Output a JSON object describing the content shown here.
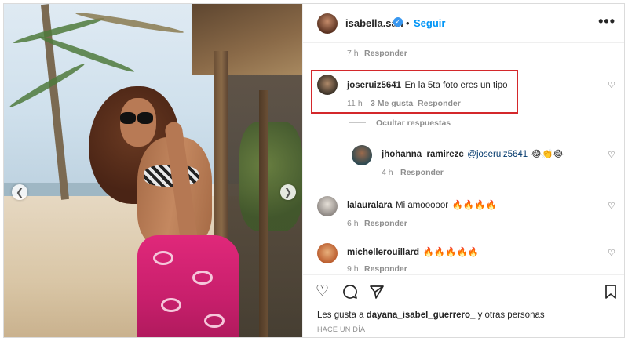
{
  "post": {
    "username": "isabella.san",
    "follow_label": "Seguir",
    "dot": "•",
    "more_label": "•••"
  },
  "comments": {
    "first_meta_time": "7 h",
    "first_meta_reply": "Responder",
    "c1": {
      "username": "joseruiz5641",
      "text": "En la 5ta foto eres un tipo",
      "time": "11 h",
      "likes": "3 Me gusta",
      "reply": "Responder"
    },
    "hide_replies": "Ocultar respuestas",
    "r1": {
      "username": "jhohanna_ramirezc",
      "mention": "@joseruiz5641",
      "emojis": "😂👏😂",
      "time": "4 h",
      "reply": "Responder"
    },
    "c2": {
      "username": "lalauralara",
      "text": "Mi amooooor",
      "emojis": "🔥🔥🔥🔥",
      "time": "6 h",
      "reply": "Responder"
    },
    "c3": {
      "username": "michellerouillard",
      "emojis": "🔥🔥🔥🔥🔥",
      "time": "9 h",
      "reply": "Responder"
    }
  },
  "footer": {
    "likes_prefix": "Les gusta a",
    "likes_user": "dayana_isabel_guerrero_",
    "likes_suffix": "y otras personas",
    "time_ago": "HACE UN DÍA"
  },
  "icons": {
    "heart": "heart-icon",
    "comment": "comment-icon",
    "share": "share-icon",
    "save": "bookmark-icon"
  },
  "colors": {
    "highlight_border": "#d4282b",
    "link_blue": "#0095f6",
    "verified_blue": "#3897f0"
  }
}
